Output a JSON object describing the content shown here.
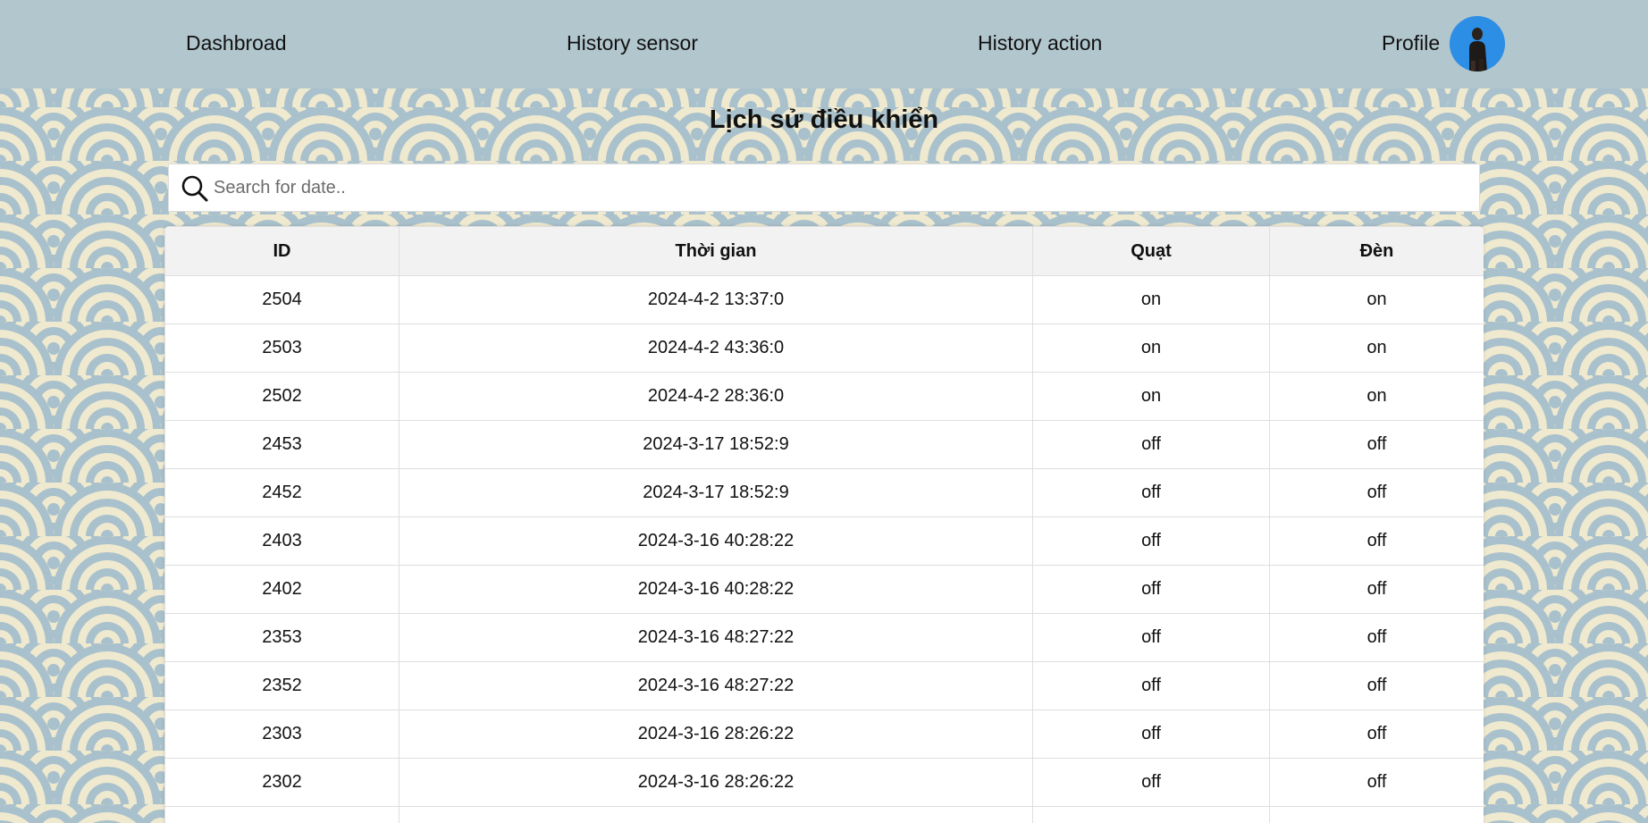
{
  "nav": {
    "dashboard": "Dashbroad",
    "history_sensor": "History sensor",
    "history_action": "History action",
    "profile": "Profile"
  },
  "page_title": "Lịch sử điều khiển",
  "search": {
    "placeholder": "Search for date..",
    "value": ""
  },
  "table": {
    "headers": [
      "ID",
      "Thời gian",
      "Quạt",
      "Đèn"
    ],
    "rows": [
      [
        "2504",
        "2024-4-2 13:37:0",
        "on",
        "on"
      ],
      [
        "2503",
        "2024-4-2 43:36:0",
        "on",
        "on"
      ],
      [
        "2502",
        "2024-4-2 28:36:0",
        "on",
        "on"
      ],
      [
        "2453",
        "2024-3-17 18:52:9",
        "off",
        "off"
      ],
      [
        "2452",
        "2024-3-17 18:52:9",
        "off",
        "off"
      ],
      [
        "2403",
        "2024-3-16 40:28:22",
        "off",
        "off"
      ],
      [
        "2402",
        "2024-3-16 40:28:22",
        "off",
        "off"
      ],
      [
        "2353",
        "2024-3-16 48:27:22",
        "off",
        "off"
      ],
      [
        "2352",
        "2024-3-16 48:27:22",
        "off",
        "off"
      ],
      [
        "2303",
        "2024-3-16 28:26:22",
        "off",
        "off"
      ],
      [
        "2302",
        "2024-3-16 28:26:22",
        "off",
        "off"
      ]
    ]
  },
  "colors": {
    "navbar": "#b2c6ce",
    "wave_blue": "#a9c1cc",
    "wave_cream": "#efe9cf",
    "avatar_bg": "#2d8ee6"
  },
  "icons": {
    "search": "search-icon",
    "avatar": "avatar"
  }
}
